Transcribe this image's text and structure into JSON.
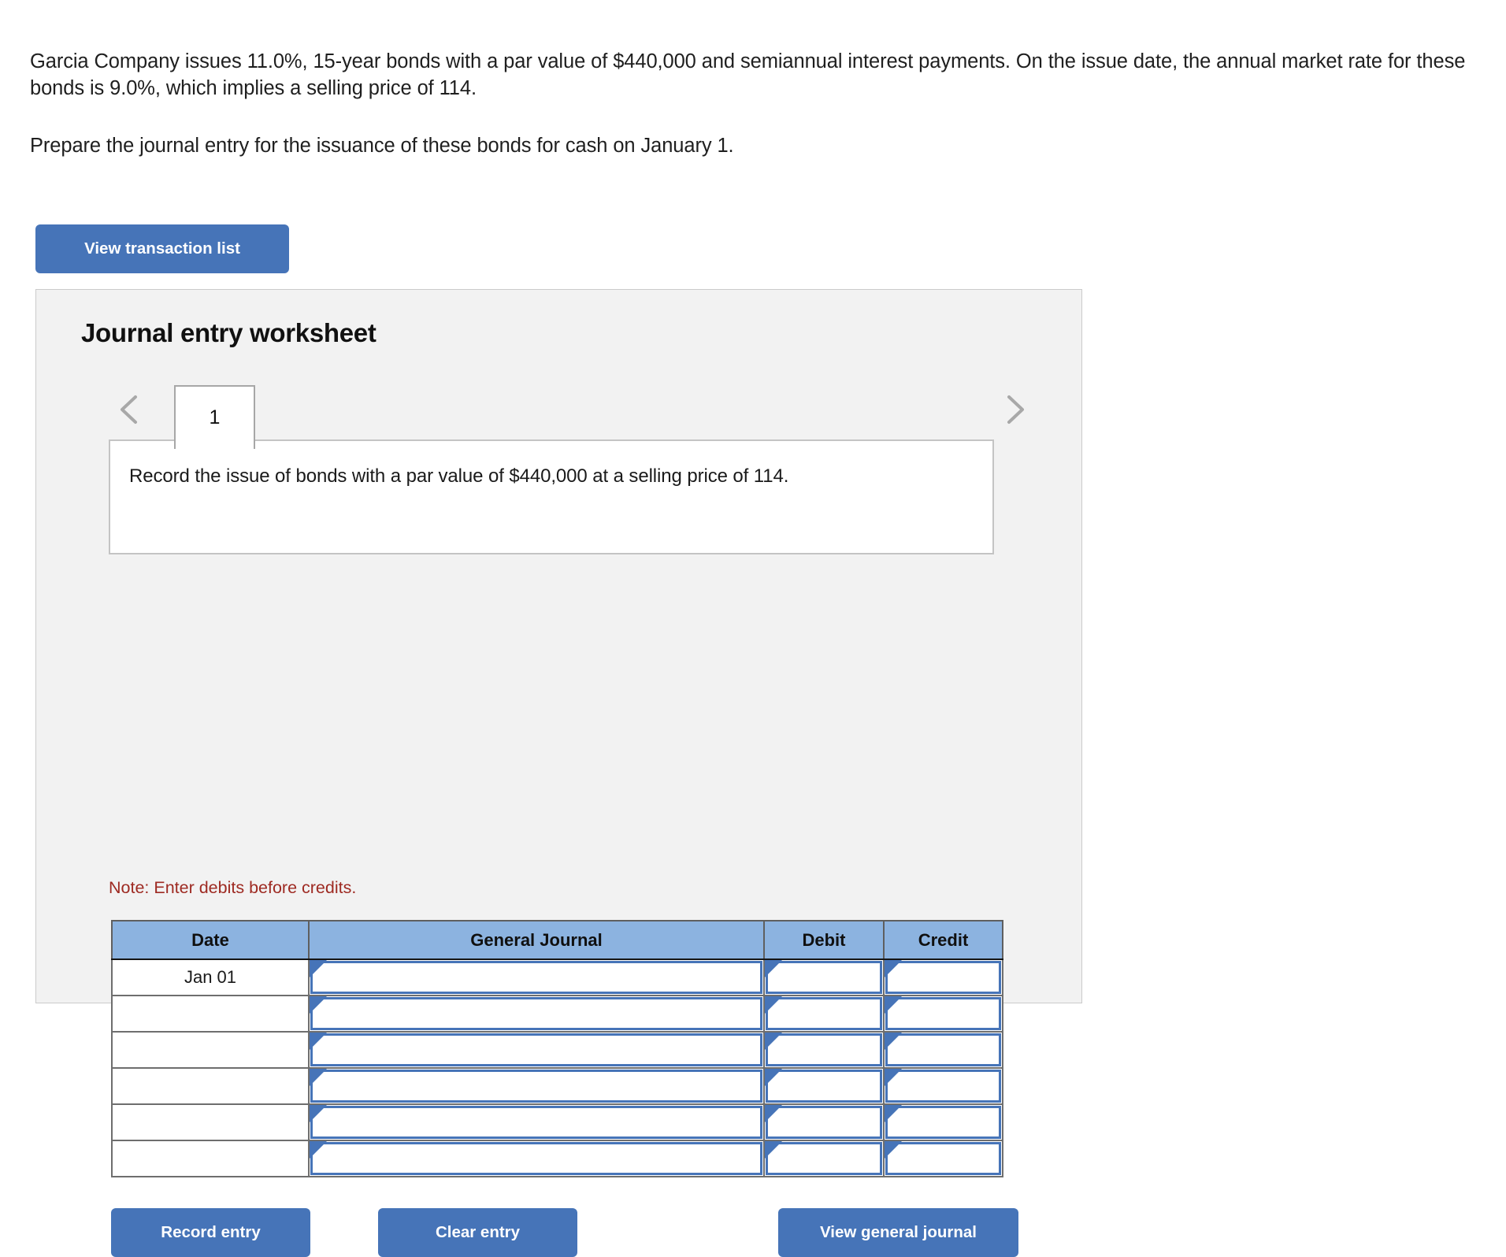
{
  "problem": {
    "paragraph_1": "Garcia Company issues 11.0%, 15-year bonds with a par value of $440,000 and semiannual interest payments. On the issue date, the annual market rate for these bonds is 9.0%, which implies a selling price of 114.",
    "paragraph_2": "Prepare the journal entry for the issuance of these bonds for cash on January 1."
  },
  "toolbar": {
    "view_transaction_list_label": "View transaction list"
  },
  "worksheet": {
    "title": "Journal entry worksheet",
    "tabs": [
      {
        "label": "1",
        "selected": true
      }
    ],
    "prev_arrow": "‹",
    "next_arrow": "›",
    "description": "Record the issue of bonds with a par value of $440,000 at a selling price of 114.",
    "note": "Note: Enter debits before credits."
  },
  "journal_table": {
    "columns": [
      "Date",
      "General Journal",
      "Debit",
      "Credit"
    ],
    "rows": [
      {
        "date": "Jan 01",
        "general_journal": "",
        "debit": "",
        "credit": ""
      },
      {
        "date": "",
        "general_journal": "",
        "debit": "",
        "credit": ""
      },
      {
        "date": "",
        "general_journal": "",
        "debit": "",
        "credit": ""
      },
      {
        "date": "",
        "general_journal": "",
        "debit": "",
        "credit": ""
      },
      {
        "date": "",
        "general_journal": "",
        "debit": "",
        "credit": ""
      },
      {
        "date": "",
        "general_journal": "",
        "debit": "",
        "credit": ""
      }
    ]
  },
  "footer": {
    "record_entry_label": "Record entry",
    "clear_entry_label": "Clear entry",
    "view_general_journal_label": "View general journal"
  },
  "colors": {
    "button_blue": "#4674b8",
    "table_header_blue": "#8cb3e0",
    "panel_gray": "#f2f2f2",
    "note_red": "#9e2a22",
    "input_border_blue": "#4674b8"
  }
}
